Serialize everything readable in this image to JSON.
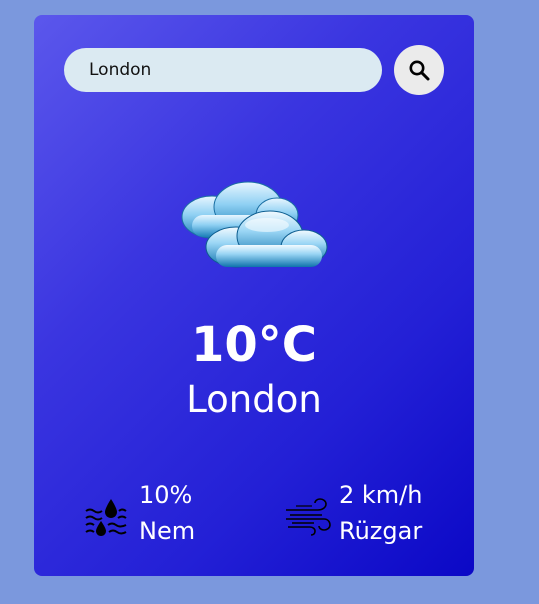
{
  "search": {
    "value": "London",
    "button_icon": "search-icon"
  },
  "weather": {
    "icon": "clouds-icon",
    "temperature": "10°C",
    "city": "London"
  },
  "details": {
    "humidity": {
      "icon": "humidity-icon",
      "value": "10%",
      "label": "Nem"
    },
    "wind": {
      "icon": "wind-icon",
      "value": "2 km/h",
      "label": "Rüzgar"
    }
  },
  "colors": {
    "background": "#7b98dd",
    "card_gradient_start": "#5b57ec",
    "card_gradient_end": "#0b08c6",
    "search_field": "#dbeaf2",
    "search_button": "#ebebeb"
  }
}
